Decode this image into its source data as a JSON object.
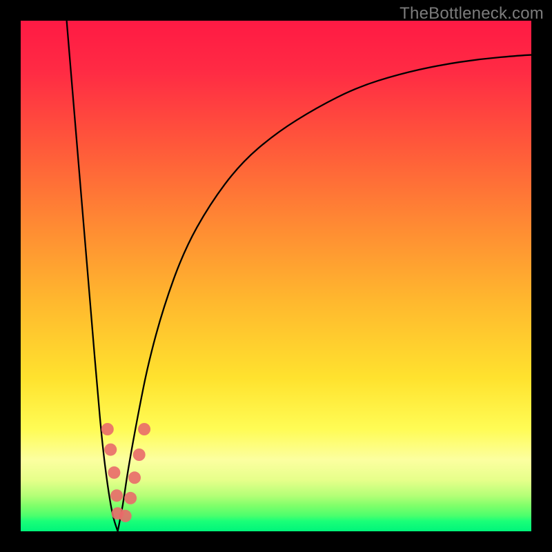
{
  "watermark": "TheBottleneck.com",
  "chart_data": {
    "type": "line",
    "title": "",
    "xlabel": "",
    "ylabel": "",
    "xlim": [
      0,
      100
    ],
    "ylim": [
      0,
      100
    ],
    "series": [
      {
        "name": "bottleneck-curve-left",
        "x": [
          9,
          10,
          11,
          12,
          13,
          14,
          15,
          16,
          17,
          18,
          19
        ],
        "y": [
          100,
          88,
          76,
          64,
          52,
          40,
          28,
          17,
          9,
          3,
          0
        ]
      },
      {
        "name": "bottleneck-curve-right",
        "x": [
          19,
          20,
          21,
          23,
          25,
          28,
          32,
          37,
          43,
          50,
          58,
          66,
          74,
          82,
          90,
          98,
          100
        ],
        "y": [
          0,
          5,
          12,
          23,
          33,
          44,
          55,
          64,
          72,
          78,
          83,
          87,
          89.5,
          91.3,
          92.5,
          93.2,
          93.3
        ]
      }
    ],
    "markers": {
      "name": "highlight-points",
      "points": [
        {
          "x_pct": 17.0,
          "y_pct_from_top": 80.0
        },
        {
          "x_pct": 17.6,
          "y_pct_from_top": 84.0
        },
        {
          "x_pct": 18.3,
          "y_pct_from_top": 88.5
        },
        {
          "x_pct": 18.8,
          "y_pct_from_top": 93.0
        },
        {
          "x_pct": 19.0,
          "y_pct_from_top": 96.5
        },
        {
          "x_pct": 20.5,
          "y_pct_from_top": 97.0
        },
        {
          "x_pct": 21.5,
          "y_pct_from_top": 93.5
        },
        {
          "x_pct": 22.3,
          "y_pct_from_top": 89.5
        },
        {
          "x_pct": 23.2,
          "y_pct_from_top": 85.0
        },
        {
          "x_pct": 24.2,
          "y_pct_from_top": 80.0
        }
      ]
    },
    "gradient_stops": [
      {
        "pos": 0.0,
        "color": "#ff1a44"
      },
      {
        "pos": 0.8,
        "color": "#fffc55"
      },
      {
        "pos": 1.0,
        "color": "#00f57a"
      }
    ]
  }
}
